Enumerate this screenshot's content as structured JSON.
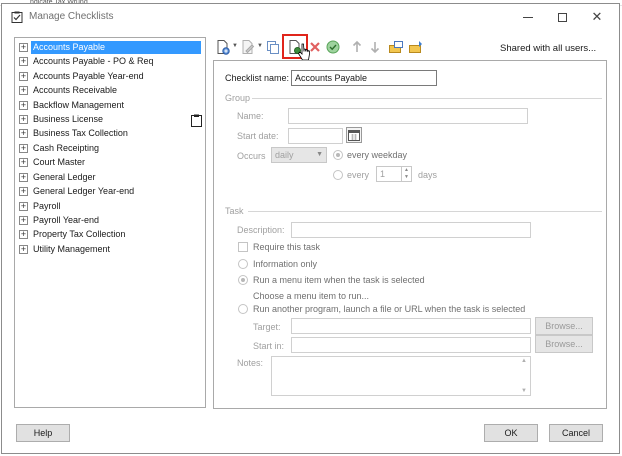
{
  "background": {
    "strip_text": "ndicate Tax Wrung"
  },
  "window": {
    "title": "Manage Checklists",
    "icon": "checklist-icon",
    "controls": {
      "minimize": "minimize-icon",
      "maximize": "maximize-icon",
      "close": "✕"
    }
  },
  "tree": {
    "expander_glyph": "+",
    "items": [
      {
        "label": "Accounts Payable",
        "selected": true
      },
      {
        "label": "Accounts Payable - PO & Req"
      },
      {
        "label": "Accounts Payable Year-end"
      },
      {
        "label": "Accounts Receivable"
      },
      {
        "label": "Backflow Management"
      },
      {
        "label": "Business License"
      },
      {
        "label": "Business Tax Collection"
      },
      {
        "label": "Cash Receipting"
      },
      {
        "label": "Court Master"
      },
      {
        "label": "General Ledger"
      },
      {
        "label": "General Ledger Year-end"
      },
      {
        "label": "Payroll"
      },
      {
        "label": "Payroll Year-end"
      },
      {
        "label": "Property Tax Collection"
      },
      {
        "label": "Utility Management"
      }
    ]
  },
  "toolbar": {
    "buttons": [
      "new-checklist-icon",
      "dropdown-arrow-icon",
      "edit-icon",
      "dropdown-arrow-icon",
      "copy-icon",
      "new-item-icon",
      "delete-icon",
      "check-circle-icon",
      "move-up-icon",
      "move-down-icon",
      "export-icon",
      "import-icon"
    ],
    "shared_label": "Shared with all users..."
  },
  "form": {
    "checklist_name_label": "Checklist name:",
    "checklist_name_value": "Accounts Payable",
    "group": {
      "heading": "Group",
      "name_label": "Name:",
      "start_date_label": "Start date:",
      "occurs_label": "Occurs",
      "occurs_value": "daily",
      "every_weekday_label": "every weekday",
      "every_label": "every",
      "every_value": "1",
      "days_label": "days"
    },
    "task": {
      "heading": "Task",
      "description_label": "Description:",
      "require_label": "Require this task",
      "info_only_label": "Information only",
      "run_menu_label": "Run a menu item when the task is selected",
      "choose_menu_label": "Choose a menu item to run...",
      "run_program_label": "Run another program, launch a file or URL when the task is selected",
      "target_label": "Target:",
      "start_in_label": "Start in:",
      "browse_label": "Browse...",
      "notes_label": "Notes:"
    }
  },
  "footer": {
    "help": "Help",
    "ok": "OK",
    "cancel": "Cancel"
  },
  "colors": {
    "selection": "#3399ff",
    "highlight": "#e0251b",
    "disabled_text": "#a0a0a0"
  }
}
